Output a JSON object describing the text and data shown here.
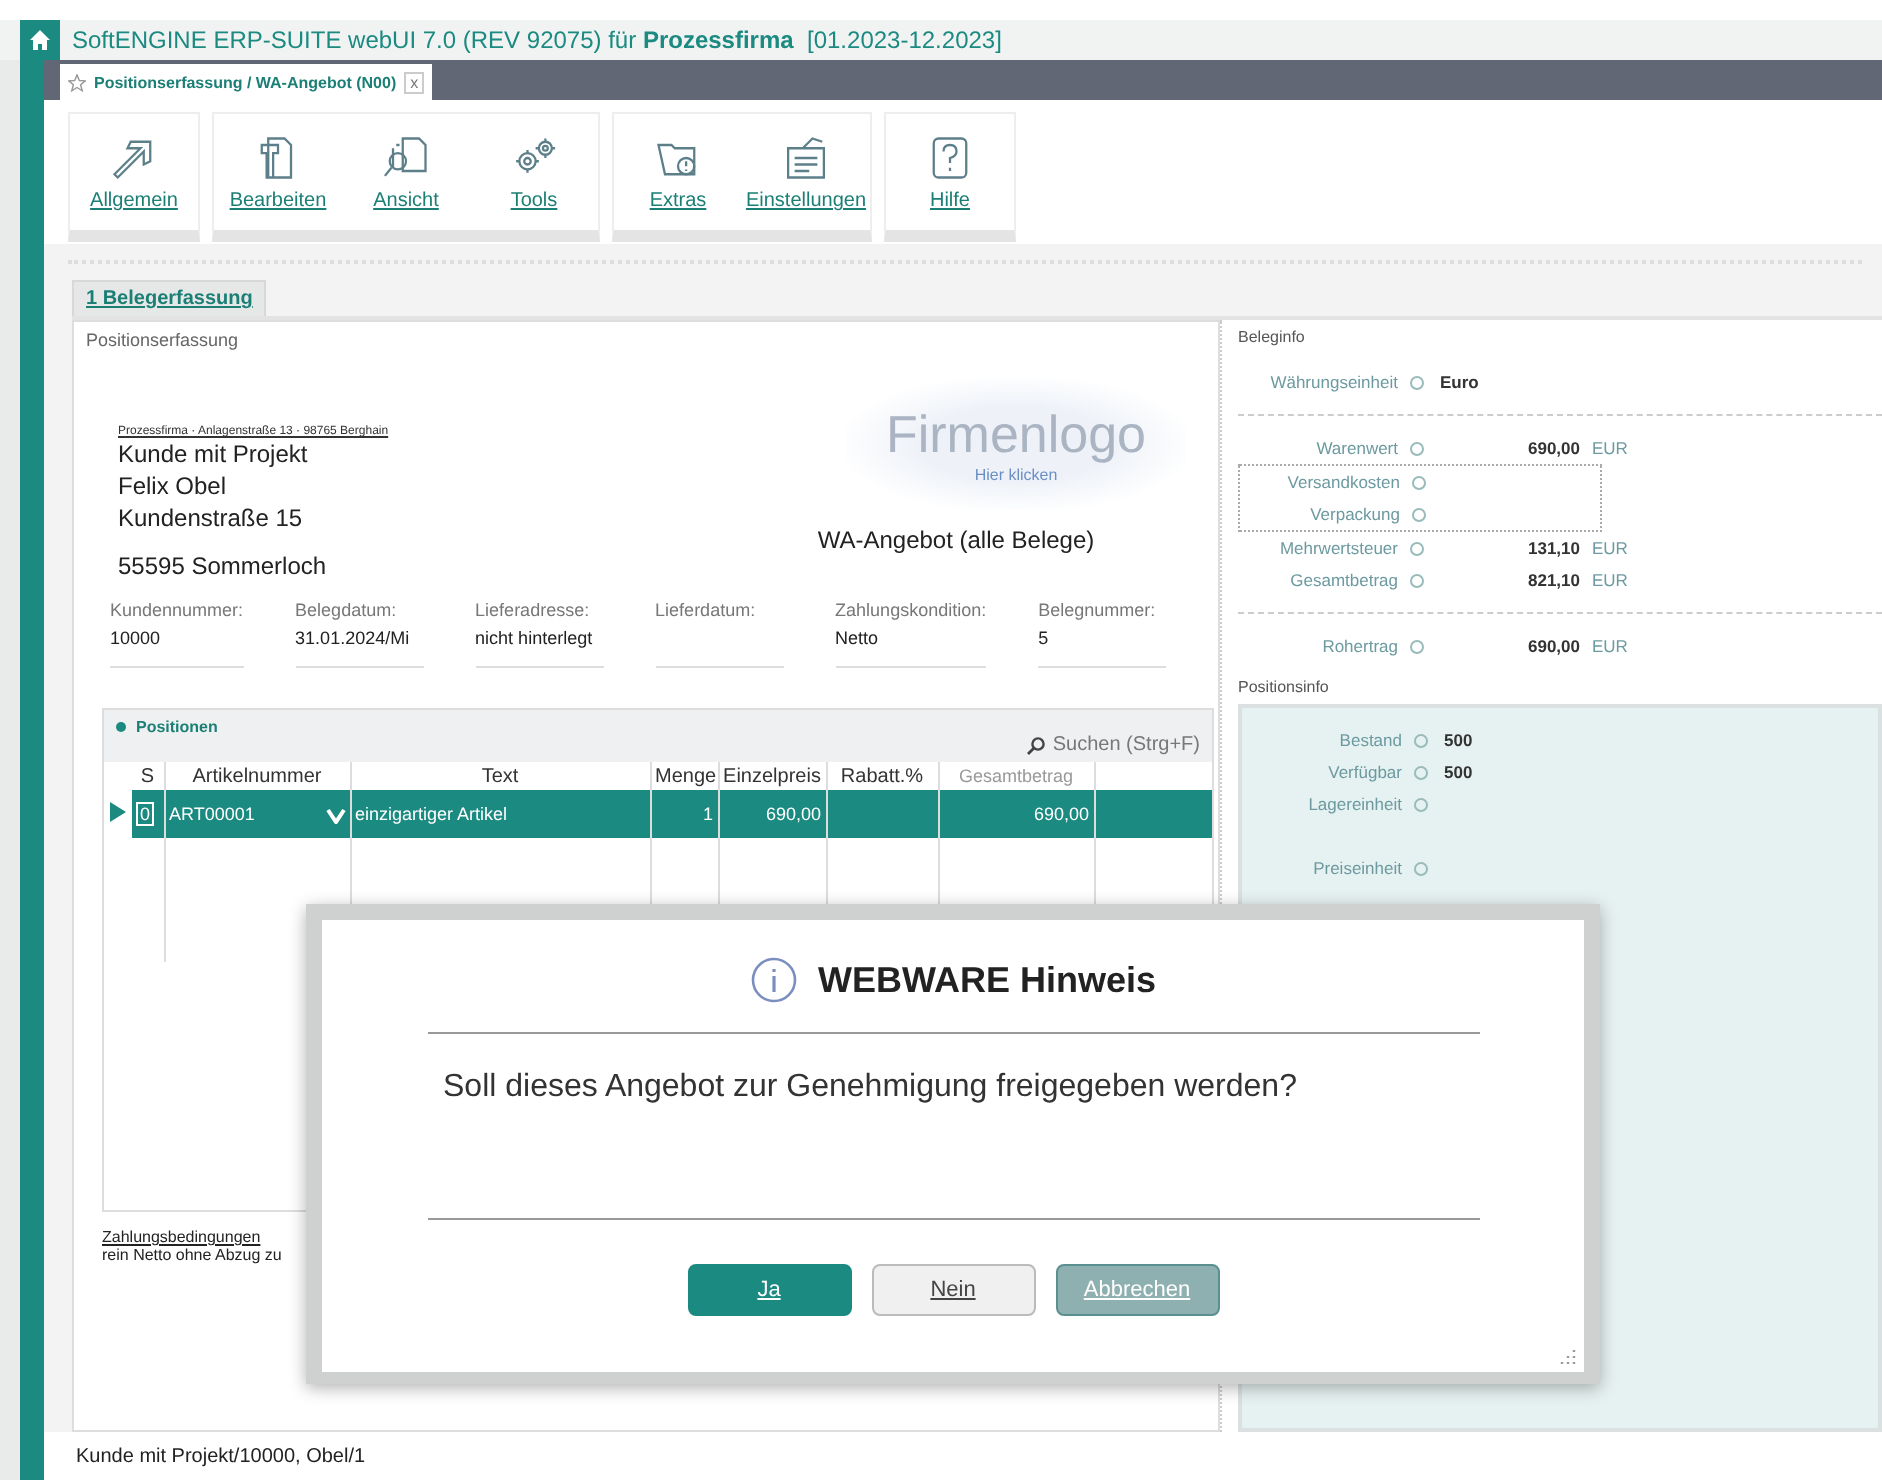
{
  "title_bar": {
    "app": "SoftENGINE ERP-SUITE webUI 7.0 (REV 92075) für",
    "company": "Prozessfirma",
    "period": "[01.2023-12.2023]"
  },
  "document_tab": {
    "label": "Positionserfassung / WA-Angebot (N00)",
    "close": "x"
  },
  "toolbar_groups": [
    {
      "items": [
        {
          "label": "Allgemein"
        }
      ]
    },
    {
      "items": [
        {
          "label": "Bearbeiten"
        },
        {
          "label": "Ansicht"
        },
        {
          "label": "Tools"
        }
      ]
    },
    {
      "items": [
        {
          "label": "Extras"
        },
        {
          "label": "Einstellungen"
        }
      ]
    },
    {
      "items": [
        {
          "label": "Hilfe"
        }
      ]
    }
  ],
  "section_tab": "1 Belegerfassung",
  "positionserfassung": {
    "title": "Positionserfassung",
    "sender_line": "Prozessfirma · Anlagenstraße 13 · 98765 Berghain",
    "address": [
      "Kunde mit Projekt",
      "Felix Obel",
      "Kundenstraße 15"
    ],
    "city": "55595 Sommerloch",
    "logo": {
      "text": "Firmenlogo",
      "link": "Hier klicken"
    },
    "document_title": "WA-Angebot (alle Belege)",
    "fields": [
      {
        "label": "Kundennummer:",
        "value": "10000"
      },
      {
        "label": "Belegdatum:",
        "value": "31.01.2024/Mi"
      },
      {
        "label": "Lieferadresse:",
        "value": "nicht hinterlegt"
      },
      {
        "label": "Lieferdatum:"
      },
      {
        "label": "Zahlungskondition:",
        "value": "Netto"
      },
      {
        "label": "Belegnummer:",
        "value": "5"
      }
    ]
  },
  "positions": {
    "title": "Positionen",
    "search": "Suchen (Strg+F)",
    "columns": [
      "S",
      "Artikelnummer",
      "Text",
      "Menge",
      "Einzelpreis",
      "Rabatt.%",
      "Gesamtbetrag"
    ],
    "rows": [
      {
        "selected": true,
        "s": "0",
        "artikelnummer": "ART00001",
        "text": "einzigartiger Artikel",
        "menge": "1",
        "einzelpreis": "690,00",
        "gesamtbetrag": "690,00"
      }
    ]
  },
  "payment": {
    "title": "Zahlungsbedingungen",
    "text": "rein Netto ohne Abzug zu"
  },
  "beleginfo": {
    "title": "Beleginfo",
    "currency": {
      "label": "Währungseinheit",
      "value": "Euro"
    },
    "amounts": [
      {
        "label": "Warenwert",
        "value": "690,00",
        "unit": "EUR"
      },
      {
        "label": "Versandkosten",
        "kind": "extra"
      },
      {
        "label": "Verpackung",
        "kind": "extra"
      },
      {
        "label": "Mehrwertsteuer",
        "value": "131,10",
        "unit": "EUR"
      },
      {
        "label": "Gesamtbetrag",
        "value": "821,10",
        "unit": "EUR"
      }
    ],
    "profit": {
      "label": "Rohertrag",
      "value": "690,00",
      "unit": "EUR"
    }
  },
  "positionsinfo": {
    "title": "Positionsinfo",
    "rows": [
      {
        "label": "Bestand",
        "value": "500"
      },
      {
        "label": "Verfügbar",
        "value": "500"
      },
      {
        "label": "Lagereinheit"
      },
      {
        "label": "Preiseinheit"
      }
    ]
  },
  "dialog": {
    "title": "WEBWARE Hinweis",
    "message": "Soll dieses Angebot zur Genehmigung freigegeben werden?",
    "buttons": [
      {
        "label": "Ja",
        "kind": "primary"
      },
      {
        "label": "Nein",
        "kind": "secondary"
      },
      {
        "label": "Abbrechen",
        "kind": "disabled"
      }
    ]
  },
  "status_bar": "Kunde mit Projekt/10000, Obel/1"
}
